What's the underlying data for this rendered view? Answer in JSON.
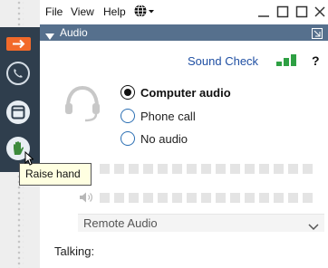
{
  "menu": {
    "file": "File",
    "view": "View",
    "help": "Help",
    "language_icon": "globe-icon"
  },
  "window_controls": [
    "minimize-icon",
    "restore-icon",
    "close-icon"
  ],
  "panel": {
    "title": "Audio",
    "collapse_icon": "caret-down-icon",
    "popout_icon": "popout-icon"
  },
  "audio": {
    "sound_check_label": "Sound Check",
    "signal_level": 3,
    "help_label": "?",
    "options": [
      {
        "label": "Computer audio",
        "selected": true
      },
      {
        "label": "Phone call",
        "selected": false
      },
      {
        "label": "No audio",
        "selected": false
      }
    ],
    "speaker_select_value": "Remote Audio",
    "talking_label": "Talking:"
  },
  "toolbar": {
    "items": [
      "arrow-right-icon",
      "phone-icon",
      "window-icon",
      "raise-hand-icon"
    ],
    "tooltip": "Raise hand"
  },
  "colors": {
    "accent_orange": "#f26a2a",
    "toolbar_bg": "#2f3e4d",
    "panel_header": "#56708d",
    "link_blue": "#1f4fa3",
    "signal_green": "#2ea043"
  }
}
